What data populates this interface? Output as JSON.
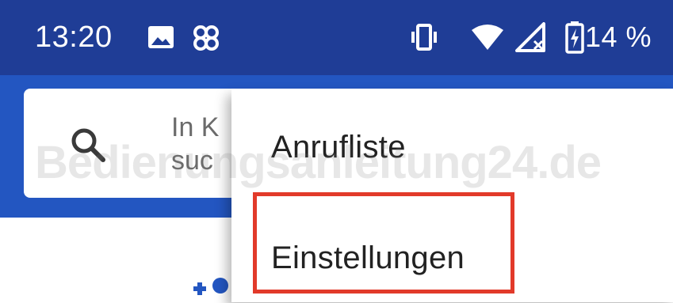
{
  "statusbar": {
    "time": "13:20",
    "icons": [
      "image-notification-icon",
      "pinwheel-icon",
      "vibrate-icon",
      "wifi-icon",
      "mobile-signal-off-icon",
      "battery-charging-icon"
    ],
    "battery_percent": "14 %"
  },
  "search": {
    "hint": "In K\nsuc"
  },
  "menu": {
    "items": [
      {
        "label": "Anrufliste"
      },
      {
        "label": "Einstellungen"
      }
    ]
  },
  "watermark": "Bedienungsanleitung24.de",
  "colors": {
    "statusbar": "#1f3d96",
    "appbar": "#2356c1",
    "highlight": "#e23a2a"
  }
}
